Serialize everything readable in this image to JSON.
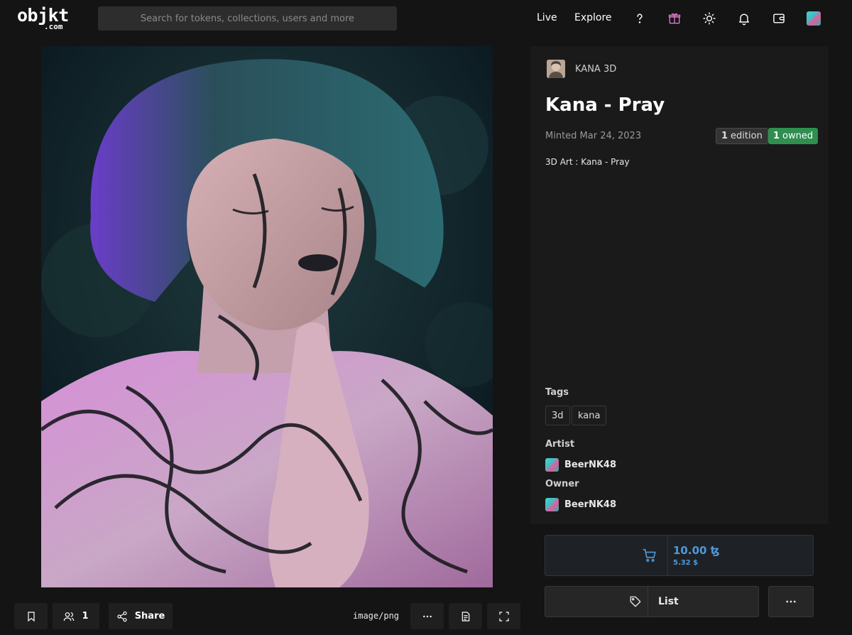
{
  "header": {
    "logo_main": "objkt",
    "logo_sub": ".com",
    "search_placeholder": "Search for tokens, collections, users and more",
    "nav": [
      {
        "label": "Live"
      },
      {
        "label": "Explore"
      }
    ],
    "icons": [
      "help-icon",
      "gift-icon",
      "sun-icon",
      "bell-icon",
      "wallet-icon",
      "user-avatar"
    ]
  },
  "artwork": {
    "mime_type": "image/png"
  },
  "toolbar": {
    "owners_count": "1",
    "share_label": "Share"
  },
  "token": {
    "creator": "KANA 3D",
    "title": "Kana - Pray",
    "minted": "Minted Mar 24, 2023",
    "editions_count": "1",
    "editions_label": "edition",
    "owned_count": "1",
    "owned_label": "owned",
    "description": "3D Art : Kana - Pray"
  },
  "tags": {
    "label": "Tags",
    "items": [
      "3d",
      "kana"
    ]
  },
  "artist": {
    "label": "Artist",
    "name": "BeerNK48"
  },
  "owner": {
    "label": "Owner",
    "name": "BeerNK48"
  },
  "buy": {
    "price": "10.00 ꜩ",
    "usd": "5.32 $"
  },
  "list": {
    "label": "List"
  },
  "colors": {
    "background": "#141414",
    "panel": "#1a1a1a",
    "accent_blue": "#4f98d8",
    "owned_green": "#2f8f4e"
  }
}
